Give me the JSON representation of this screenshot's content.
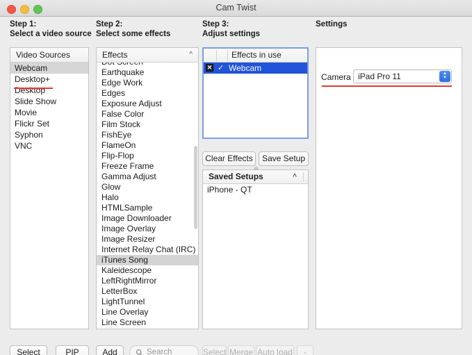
{
  "window": {
    "title": "Cam Twist",
    "traffic_lights": [
      "close-button",
      "minimize-button",
      "zoom-button"
    ],
    "accent_blue": "#2154d8",
    "annotation_red": "#e03a2f"
  },
  "steps": {
    "step1": "Step 1:\nSelect a video source",
    "step2": "Step 2:\nSelect some effects",
    "step3": "Step 3:\nAdjust settings",
    "settings": "Settings"
  },
  "video_sources": {
    "header": "Video Sources",
    "selected": "Webcam",
    "items": [
      "Webcam",
      "Desktop+",
      "Desktop",
      "Slide Show",
      "Movie",
      "Flickr Set",
      "Syphon",
      "VNC"
    ]
  },
  "effects": {
    "header": "Effects",
    "collapse_icon": "chevron-up-icon",
    "selected": "iTunes Song",
    "items": [
      "Dot Screen",
      "Earthquake",
      "Edge Work",
      "Edges",
      "Exposure Adjust",
      "False Color",
      "Film Stock",
      "FishEye",
      "FlameOn",
      "Flip-Flop",
      "Freeze Frame",
      "Gamma Adjust",
      "Glow",
      "Halo",
      "HTMLSample",
      "Image Downloader",
      "Image Overlay",
      "Image Resizer",
      "Internet Relay Chat (IRC)",
      "iTunes Song",
      "Kaleidescope",
      "LeftRightMirror",
      "LetterBox",
      "LightTunnel",
      "Line Overlay",
      "Line Screen"
    ]
  },
  "effects_in_use": {
    "header": "Effects in use",
    "rows": [
      {
        "label": "Webcam",
        "remove_glyph": "✕",
        "enabled_glyph": "✓",
        "selected": true
      }
    ]
  },
  "step3_buttons": {
    "clear_effects": "Clear Effects",
    "save_setup": "Save Setup"
  },
  "saved_setups": {
    "header": "Saved Setups",
    "collapse_icon": "chevron-up-icon",
    "items": [
      "iPhone - QT"
    ]
  },
  "settings": {
    "camera_label": "Camera",
    "camera_value": "iPad Pro 11",
    "stepper_glyph": "⌃⌄"
  },
  "toolbar": {
    "select": "Select",
    "pip": "PIP",
    "add": "Add",
    "search_placeholder": "Search",
    "select_right": "Select",
    "merge": "Merge",
    "auto_load": "Auto load",
    "minus": "-"
  }
}
